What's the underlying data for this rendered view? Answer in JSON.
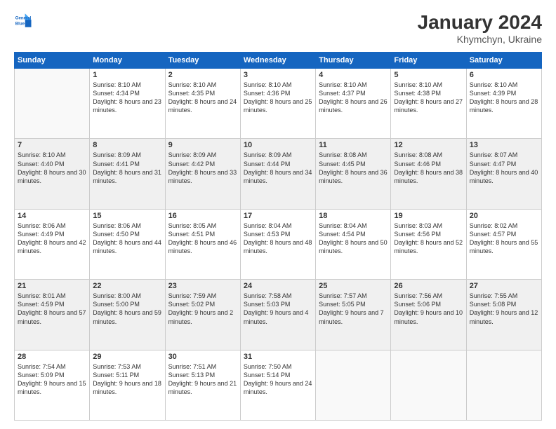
{
  "header": {
    "logo_line1": "General",
    "logo_line2": "Blue",
    "title": "January 2024",
    "subtitle": "Khymchyn, Ukraine"
  },
  "days_of_week": [
    "Sunday",
    "Monday",
    "Tuesday",
    "Wednesday",
    "Thursday",
    "Friday",
    "Saturday"
  ],
  "weeks": [
    [
      {
        "day": "",
        "sunrise": "",
        "sunset": "",
        "daylight": ""
      },
      {
        "day": "1",
        "sunrise": "Sunrise: 8:10 AM",
        "sunset": "Sunset: 4:34 PM",
        "daylight": "Daylight: 8 hours and 23 minutes."
      },
      {
        "day": "2",
        "sunrise": "Sunrise: 8:10 AM",
        "sunset": "Sunset: 4:35 PM",
        "daylight": "Daylight: 8 hours and 24 minutes."
      },
      {
        "day": "3",
        "sunrise": "Sunrise: 8:10 AM",
        "sunset": "Sunset: 4:36 PM",
        "daylight": "Daylight: 8 hours and 25 minutes."
      },
      {
        "day": "4",
        "sunrise": "Sunrise: 8:10 AM",
        "sunset": "Sunset: 4:37 PM",
        "daylight": "Daylight: 8 hours and 26 minutes."
      },
      {
        "day": "5",
        "sunrise": "Sunrise: 8:10 AM",
        "sunset": "Sunset: 4:38 PM",
        "daylight": "Daylight: 8 hours and 27 minutes."
      },
      {
        "day": "6",
        "sunrise": "Sunrise: 8:10 AM",
        "sunset": "Sunset: 4:39 PM",
        "daylight": "Daylight: 8 hours and 28 minutes."
      }
    ],
    [
      {
        "day": "7",
        "sunrise": "Sunrise: 8:10 AM",
        "sunset": "Sunset: 4:40 PM",
        "daylight": "Daylight: 8 hours and 30 minutes."
      },
      {
        "day": "8",
        "sunrise": "Sunrise: 8:09 AM",
        "sunset": "Sunset: 4:41 PM",
        "daylight": "Daylight: 8 hours and 31 minutes."
      },
      {
        "day": "9",
        "sunrise": "Sunrise: 8:09 AM",
        "sunset": "Sunset: 4:42 PM",
        "daylight": "Daylight: 8 hours and 33 minutes."
      },
      {
        "day": "10",
        "sunrise": "Sunrise: 8:09 AM",
        "sunset": "Sunset: 4:44 PM",
        "daylight": "Daylight: 8 hours and 34 minutes."
      },
      {
        "day": "11",
        "sunrise": "Sunrise: 8:08 AM",
        "sunset": "Sunset: 4:45 PM",
        "daylight": "Daylight: 8 hours and 36 minutes."
      },
      {
        "day": "12",
        "sunrise": "Sunrise: 8:08 AM",
        "sunset": "Sunset: 4:46 PM",
        "daylight": "Daylight: 8 hours and 38 minutes."
      },
      {
        "day": "13",
        "sunrise": "Sunrise: 8:07 AM",
        "sunset": "Sunset: 4:47 PM",
        "daylight": "Daylight: 8 hours and 40 minutes."
      }
    ],
    [
      {
        "day": "14",
        "sunrise": "Sunrise: 8:06 AM",
        "sunset": "Sunset: 4:49 PM",
        "daylight": "Daylight: 8 hours and 42 minutes."
      },
      {
        "day": "15",
        "sunrise": "Sunrise: 8:06 AM",
        "sunset": "Sunset: 4:50 PM",
        "daylight": "Daylight: 8 hours and 44 minutes."
      },
      {
        "day": "16",
        "sunrise": "Sunrise: 8:05 AM",
        "sunset": "Sunset: 4:51 PM",
        "daylight": "Daylight: 8 hours and 46 minutes."
      },
      {
        "day": "17",
        "sunrise": "Sunrise: 8:04 AM",
        "sunset": "Sunset: 4:53 PM",
        "daylight": "Daylight: 8 hours and 48 minutes."
      },
      {
        "day": "18",
        "sunrise": "Sunrise: 8:04 AM",
        "sunset": "Sunset: 4:54 PM",
        "daylight": "Daylight: 8 hours and 50 minutes."
      },
      {
        "day": "19",
        "sunrise": "Sunrise: 8:03 AM",
        "sunset": "Sunset: 4:56 PM",
        "daylight": "Daylight: 8 hours and 52 minutes."
      },
      {
        "day": "20",
        "sunrise": "Sunrise: 8:02 AM",
        "sunset": "Sunset: 4:57 PM",
        "daylight": "Daylight: 8 hours and 55 minutes."
      }
    ],
    [
      {
        "day": "21",
        "sunrise": "Sunrise: 8:01 AM",
        "sunset": "Sunset: 4:59 PM",
        "daylight": "Daylight: 8 hours and 57 minutes."
      },
      {
        "day": "22",
        "sunrise": "Sunrise: 8:00 AM",
        "sunset": "Sunset: 5:00 PM",
        "daylight": "Daylight: 8 hours and 59 minutes."
      },
      {
        "day": "23",
        "sunrise": "Sunrise: 7:59 AM",
        "sunset": "Sunset: 5:02 PM",
        "daylight": "Daylight: 9 hours and 2 minutes."
      },
      {
        "day": "24",
        "sunrise": "Sunrise: 7:58 AM",
        "sunset": "Sunset: 5:03 PM",
        "daylight": "Daylight: 9 hours and 4 minutes."
      },
      {
        "day": "25",
        "sunrise": "Sunrise: 7:57 AM",
        "sunset": "Sunset: 5:05 PM",
        "daylight": "Daylight: 9 hours and 7 minutes."
      },
      {
        "day": "26",
        "sunrise": "Sunrise: 7:56 AM",
        "sunset": "Sunset: 5:06 PM",
        "daylight": "Daylight: 9 hours and 10 minutes."
      },
      {
        "day": "27",
        "sunrise": "Sunrise: 7:55 AM",
        "sunset": "Sunset: 5:08 PM",
        "daylight": "Daylight: 9 hours and 12 minutes."
      }
    ],
    [
      {
        "day": "28",
        "sunrise": "Sunrise: 7:54 AM",
        "sunset": "Sunset: 5:09 PM",
        "daylight": "Daylight: 9 hours and 15 minutes."
      },
      {
        "day": "29",
        "sunrise": "Sunrise: 7:53 AM",
        "sunset": "Sunset: 5:11 PM",
        "daylight": "Daylight: 9 hours and 18 minutes."
      },
      {
        "day": "30",
        "sunrise": "Sunrise: 7:51 AM",
        "sunset": "Sunset: 5:13 PM",
        "daylight": "Daylight: 9 hours and 21 minutes."
      },
      {
        "day": "31",
        "sunrise": "Sunrise: 7:50 AM",
        "sunset": "Sunset: 5:14 PM",
        "daylight": "Daylight: 9 hours and 24 minutes."
      },
      {
        "day": "",
        "sunrise": "",
        "sunset": "",
        "daylight": ""
      },
      {
        "day": "",
        "sunrise": "",
        "sunset": "",
        "daylight": ""
      },
      {
        "day": "",
        "sunrise": "",
        "sunset": "",
        "daylight": ""
      }
    ]
  ]
}
